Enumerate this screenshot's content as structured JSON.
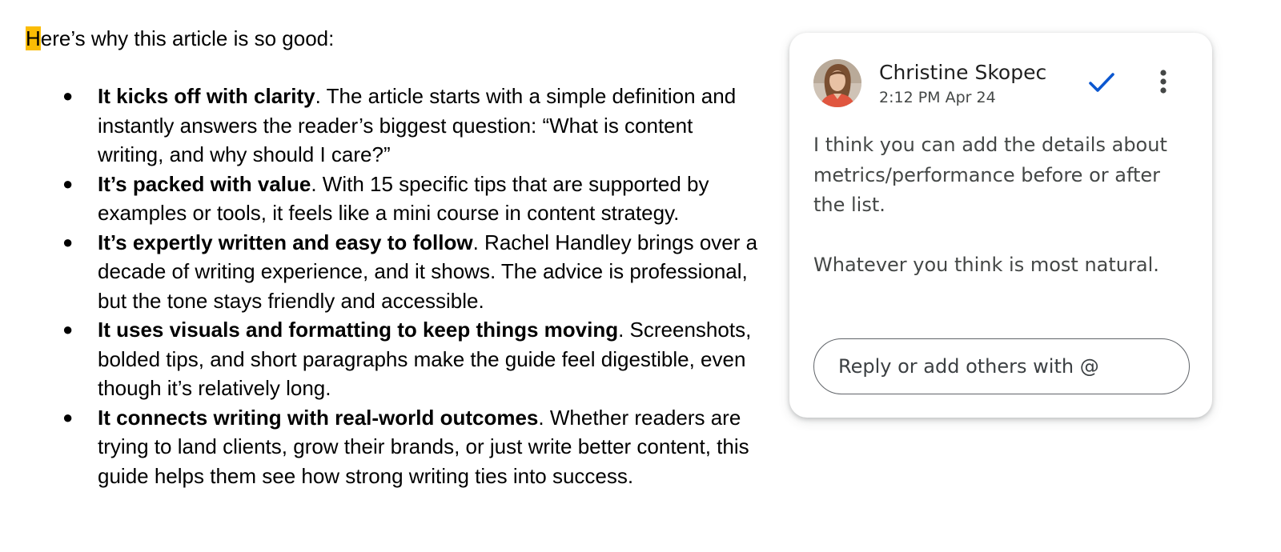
{
  "document": {
    "intro_first_letter": "H",
    "intro_rest": "ere’s why this article is so good:",
    "highlight_color": "#fbbc04",
    "bullets": [
      {
        "bold": "It kicks off with clarity",
        "text": ". The article starts with a simple definition and instantly answers the reader’s biggest question: “What is content writing, and why should I care?”"
      },
      {
        "bold": "It’s packed with value",
        "text": ". With 15 specific tips that are supported by examples or tools, it feels like a mini course in content strategy."
      },
      {
        "bold": "It’s expertly written and easy to follow",
        "text": ". Rachel Handley brings over a decade of writing experience, and it shows. The advice is professional, but the tone stays friendly and accessible."
      },
      {
        "bold": "It uses visuals and formatting to keep things moving",
        "text": ". Screenshots, bolded tips, and short paragraphs make the guide feel digestible, even though it’s relatively long."
      },
      {
        "bold": "It connects writing with real-world outcomes",
        "text": ". Whether readers are trying to land clients, grow their brands, or just write better content, this guide helps them see how strong writing ties into success."
      }
    ]
  },
  "comment": {
    "author": "Christine Skopec",
    "timestamp": "2:12 PM Apr 24",
    "body_paragraphs": [
      "I think you can add the details about metrics/performance before or after the list.",
      "Whatever you think is most natural."
    ],
    "reply_placeholder": "Reply or add others with @",
    "icons": {
      "resolve": "checkmark-icon",
      "more": "more-vert-icon",
      "avatar": "avatar"
    },
    "resolve_color": "#0b57d0"
  }
}
